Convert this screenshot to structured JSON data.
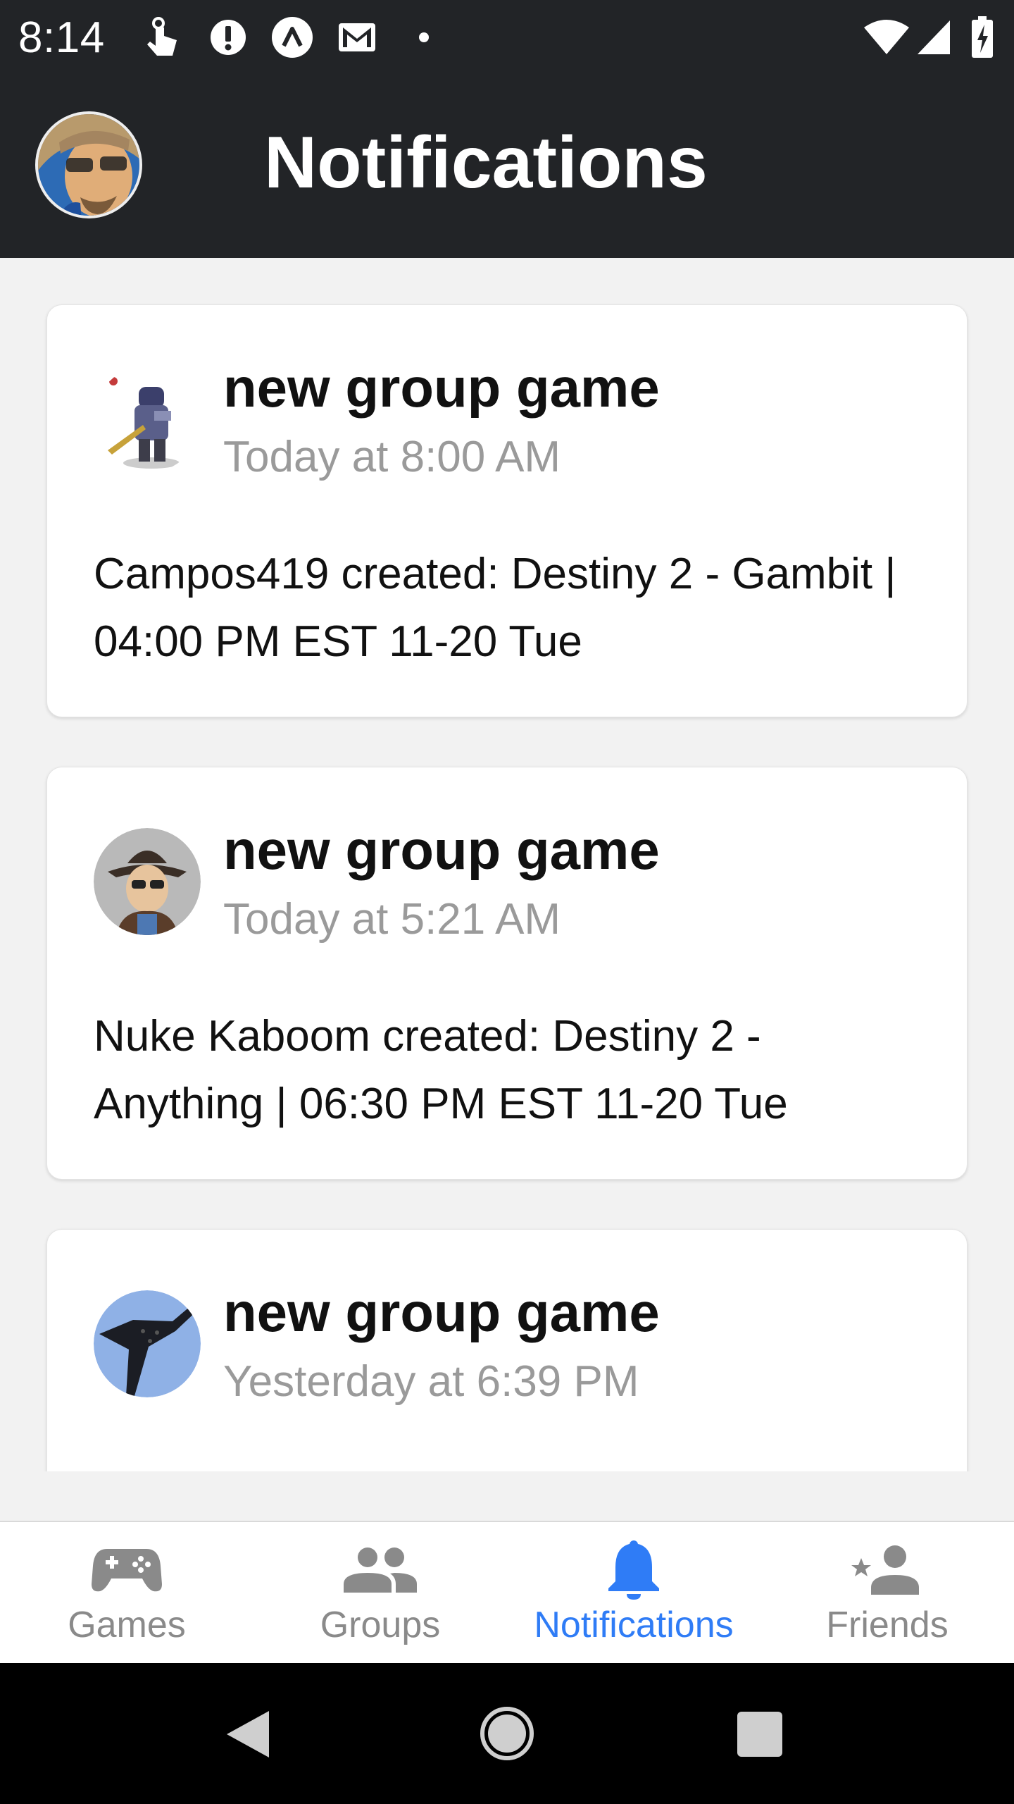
{
  "status_bar": {
    "time": "8:14"
  },
  "header": {
    "title": "Notifications"
  },
  "notifications": [
    {
      "title": "new group game",
      "time": "Today at 8:00 AM",
      "body": "Campos419 created: Destiny 2 - Gambit | 04:00 PM EST 11-20 Tue"
    },
    {
      "title": "new group game",
      "time": "Today at 5:21 AM",
      "body": "Nuke Kaboom created: Destiny 2 - Anything | 06:30 PM EST 11-20 Tue"
    },
    {
      "title": "new group game",
      "time": "Yesterday at 6:39 PM",
      "body": ""
    }
  ],
  "bottom_nav": {
    "items": [
      {
        "label": "Games",
        "icon": "gamepad-icon"
      },
      {
        "label": "Groups",
        "icon": "groups-icon"
      },
      {
        "label": "Notifications",
        "icon": "bell-icon",
        "active": true
      },
      {
        "label": "Friends",
        "icon": "friends-icon"
      }
    ]
  },
  "colors": {
    "header_bg": "#222427",
    "accent": "#2f7cf6",
    "page_bg": "#f2f2f2",
    "muted_text": "#9a9a9a"
  }
}
